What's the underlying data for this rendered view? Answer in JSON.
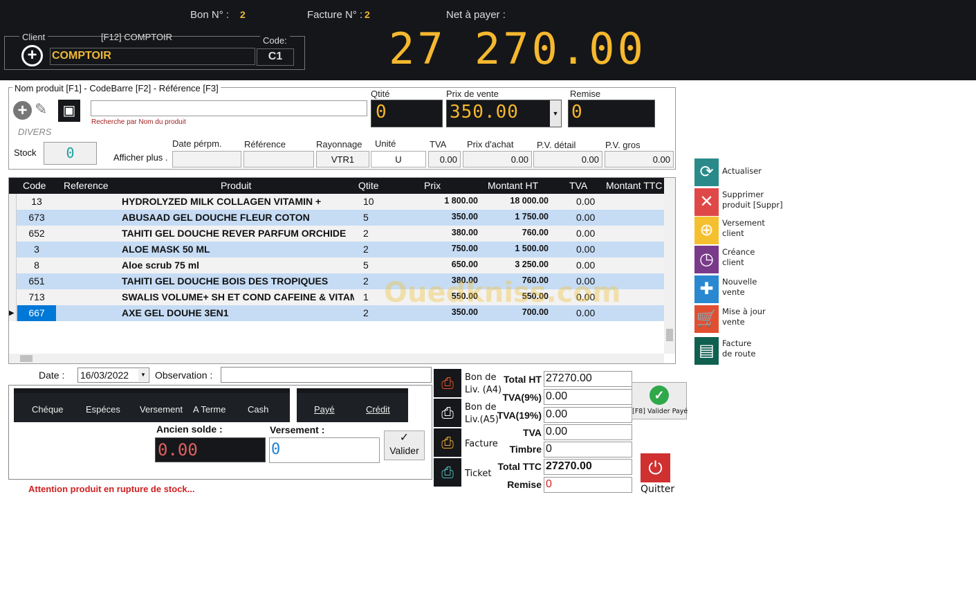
{
  "header": {
    "bon_label": "Bon N° :",
    "bon_value": "2",
    "facture_label": "Facture N° :",
    "facture_value": "2",
    "net_label": "Net à payer :",
    "net_value": "27 270.00"
  },
  "client": {
    "label": "Client",
    "shortcut": "[F12] COMPTOIR",
    "code_label": "Code:",
    "name": "COMPTOIR",
    "code": "C1"
  },
  "product": {
    "legend": "Nom produit [F1]  - CodeBarre [F2] - Référence [F3]",
    "search_value": "",
    "search_hint": "Recherche par Nom du produit",
    "divers": "DIVERS",
    "stock_label": "Stock",
    "stock_value": "0",
    "afficher_plus": "Afficher plus .",
    "qtite_label": "Qtité",
    "qtite_value": "0",
    "prix_label": "Prix de vente",
    "prix_value": "350.00",
    "remise_label": "Remise",
    "remise_value": "0",
    "date_label": "Date pérpm.",
    "date_value": "",
    "ref_label": "Référence",
    "ref_value": "",
    "ray_label": "Rayonnage",
    "ray_value": "VTR1",
    "unite_label": "Unité",
    "unite_value": "U",
    "tva_label": "TVA",
    "tva_value": "0.00",
    "pa_label": "Prix d'achat",
    "pa_value": "0.00",
    "pvd_label": "P.V. détail",
    "pvd_value": "0.00",
    "pvg_label": "P.V. gros",
    "pvg_value": "0.00"
  },
  "table": {
    "columns": [
      "Code",
      "Reference",
      "Produit",
      "Qtite",
      "Prix",
      "Montant HT",
      "TVA",
      "Montant TTC"
    ],
    "rows": [
      {
        "code": "13",
        "ref": "",
        "produit": "HYDROLYZED MILK COLLAGEN VITAMIN +",
        "qte": "10",
        "prix": "1 800.00",
        "mht": "18 000.00",
        "tva": "0.00",
        "mttc": ""
      },
      {
        "code": "673",
        "ref": "",
        "produit": "ABUSAAD GEL DOUCHE FLEUR COTON",
        "qte": "5",
        "prix": "350.00",
        "mht": "1 750.00",
        "tva": "0.00",
        "mttc": ""
      },
      {
        "code": "652",
        "ref": "",
        "produit": "TAHITI GEL DOUCHE REVER PARFUM ORCHIDE",
        "qte": "2",
        "prix": "380.00",
        "mht": "760.00",
        "tva": "0.00",
        "mttc": ""
      },
      {
        "code": "3",
        "ref": "",
        "produit": "ALOE MASK 50 ML",
        "qte": "2",
        "prix": "750.00",
        "mht": "1 500.00",
        "tva": "0.00",
        "mttc": ""
      },
      {
        "code": "8",
        "ref": "",
        "produit": "Aloe scrub 75 ml",
        "qte": "5",
        "prix": "650.00",
        "mht": "3 250.00",
        "tva": "0.00",
        "mttc": ""
      },
      {
        "code": "651",
        "ref": "",
        "produit": "TAHITI GEL DOUCHE BOIS DES TROPIQUES",
        "qte": "2",
        "prix": "380.00",
        "mht": "760.00",
        "tva": "0.00",
        "mttc": ""
      },
      {
        "code": "713",
        "ref": "",
        "produit": "SWALIS VOLUME+ SH ET COND CAFEINE & VITAMINE",
        "qte": "1",
        "prix": "550.00",
        "mht": "550.00",
        "tva": "0.00",
        "mttc": ""
      },
      {
        "code": "667",
        "ref": "",
        "produit": "AXE GEL DOUHE 3EN1",
        "qte": "2",
        "prix": "350.00",
        "mht": "700.00",
        "tva": "0.00",
        "mttc": ""
      }
    ]
  },
  "watermark": "Ouedkniss.com",
  "bottom": {
    "date_label": "Date :",
    "date_value": "16/03/2022",
    "obs_label": "Observation :",
    "obs_value": "",
    "pay_modes": [
      "Chéque",
      "Espéces",
      "Versement",
      "A Terme",
      "Cash"
    ],
    "status": [
      "Payé",
      "Crédit"
    ],
    "ancien_label": "Ancien solde :",
    "ancien_value": "0.00",
    "versement_label": "Versement :",
    "versement_value": "0",
    "valider": "Valider",
    "warning": "Attention produit en rupture de stock..."
  },
  "print": [
    {
      "l1": "Bon de",
      "l2": "Liv. (A4)",
      "color": "#e8542a"
    },
    {
      "l1": "Bon de",
      "l2": "Liv.(A5)",
      "color": "#ffffff"
    },
    {
      "l1": "Facture",
      "l2": "",
      "color": "#f0b030"
    },
    {
      "l1": "Ticket",
      "l2": "",
      "color": "#4fc0c0"
    }
  ],
  "totals": {
    "ht_label": "Total HT",
    "ht": "27270.00",
    "tva9_label": "TVA(9%)",
    "tva9": "0.00",
    "tva19_label": "TVA(19%)",
    "tva19": "0.00",
    "tva_label": "TVA",
    "tva": "0.00",
    "timbre_label": "Timbre",
    "timbre": "0",
    "ttc_label": "Total TTC",
    "ttc": "27270.00",
    "remise_label": "Remise",
    "remise": "0"
  },
  "actions": {
    "valider_paye": "[F8] Valider Payé",
    "quitter": "Quitter"
  },
  "sidebar": [
    {
      "l1": "Actualiser",
      "l2": "",
      "color": "#2a8a8a",
      "icon": "refresh-icon"
    },
    {
      "l1": "Supprimer",
      "l2": "produit [Suppr]",
      "color": "#e04848",
      "icon": "delete-icon"
    },
    {
      "l1": "Versement",
      "l2": "client",
      "color": "#f5c030",
      "icon": "folder-add-icon"
    },
    {
      "l1": "Créance",
      "l2": "client",
      "color": "#7a3a8a",
      "icon": "clock-icon"
    },
    {
      "l1": "Nouvelle",
      "l2": "vente",
      "color": "#2a88d0",
      "icon": "plus-icon"
    },
    {
      "l1": "Mise à jour",
      "l2": "vente",
      "color": "#e05030",
      "icon": "cart-icon"
    },
    {
      "l1": "Facture",
      "l2": "de route",
      "color": "#106050",
      "icon": "document-icon"
    }
  ]
}
